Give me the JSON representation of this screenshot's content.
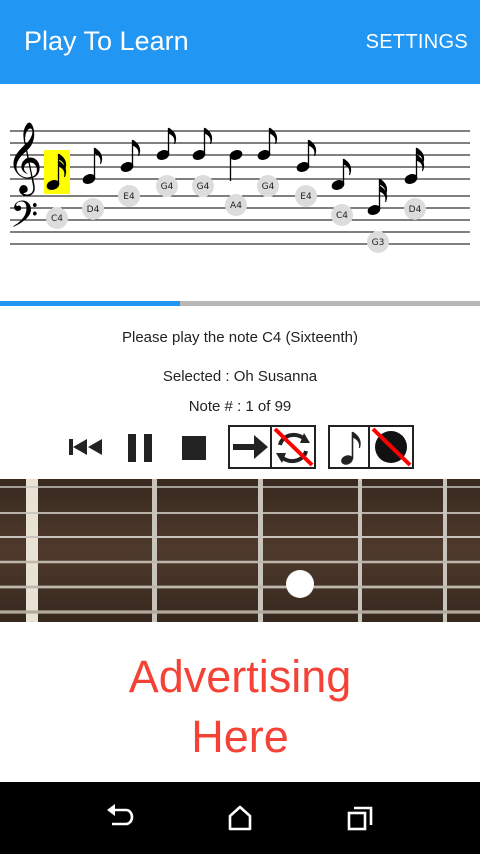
{
  "app_bar": {
    "title": "Play To Learn",
    "settings_label": "SETTINGS",
    "color": "#2196F3"
  },
  "sheet": {
    "highlight_color": "#ffff00",
    "note_labels": [
      "C4",
      "D4",
      "E4",
      "G4",
      "G4",
      "A4",
      "G4",
      "E4",
      "C4",
      "G3",
      "D4"
    ]
  },
  "progress": {
    "fraction": 0.375
  },
  "status": {
    "instruction": "Please play the note C4 (Sixteenth)",
    "selected": "Selected : Oh Susanna",
    "note_number": "Note # : 1 of 99"
  },
  "controls": {
    "icons": [
      "skip-to-start-icon",
      "pause-icon",
      "stop-icon",
      "advance-without-loop-icon",
      "note-without-record-icon"
    ]
  },
  "fretboard": {
    "dot_icon": "finger-position-dot"
  },
  "ad": {
    "line1": "Advertising",
    "line2": "Here",
    "color": "#f44336"
  },
  "nav": {
    "icons": [
      "back-icon",
      "home-icon",
      "recent-apps-icon"
    ]
  }
}
